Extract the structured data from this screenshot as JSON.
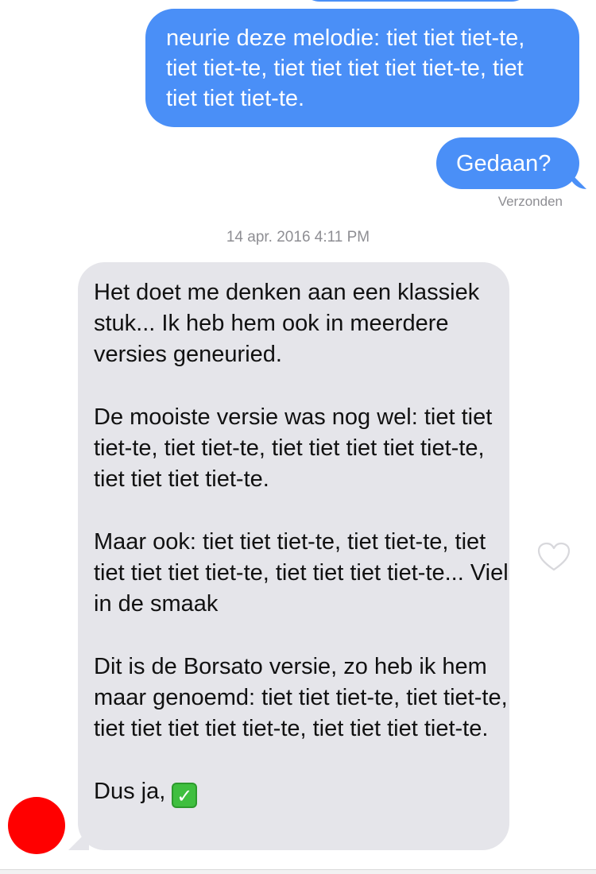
{
  "conversation": {
    "outgoing": [
      {
        "text": "neurie deze melodie: tiet tiet tiet-te, tiet tiet-te, tiet tiet tiet tiet tiet-te, tiet tiet tiet tiet-te."
      },
      {
        "text": "Gedaan?"
      }
    ],
    "delivered_label": "Verzonden",
    "timestamp": "14 apr. 2016 4:11 PM",
    "incoming": {
      "paragraphs": [
        "Het doet me denken aan een klassiek stuk... Ik heb hem ook in meerdere versies geneuried.",
        "De mooiste versie was nog wel: tiet tiet tiet-te, tiet tiet-te, tiet tiet tiet tiet tiet-te, tiet tiet tiet tiet-te.",
        "Maar ook: tiet tiet tiet-te, tiet tiet-te, tiet tiet tiet tiet tiet-te, tiet tiet tiet tiet-te... Viel in de smaak",
        "Dit is de Borsato versie, zo heb ik hem maar genoemd: tiet tiet tiet-te, tiet tiet-te, tiet tiet tiet tiet tiet-te, tiet tiet tiet tiet-te."
      ],
      "closing": "Dus ja,",
      "closing_emoji": "✓"
    }
  },
  "icons": {
    "like": "heart-outline-icon",
    "emoji": "white-check-mark-emoji"
  },
  "colors": {
    "outgoing_bubble": "#4a8ff7",
    "incoming_bubble": "#e5e5ea",
    "meta_text": "#8e8e93",
    "avatar": "#ff0000"
  }
}
